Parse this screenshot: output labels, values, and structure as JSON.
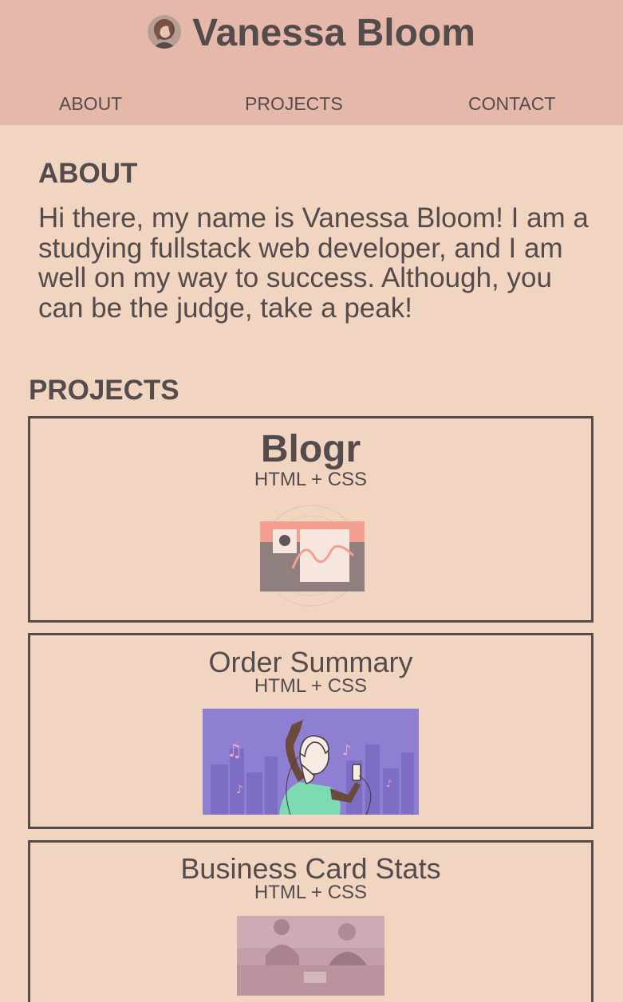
{
  "header": {
    "avatar_icon": "profile-photo",
    "title": "Vanessa Bloom",
    "nav": [
      {
        "label": "ABOUT"
      },
      {
        "label": "PROJECTS"
      },
      {
        "label": "CONTACT"
      }
    ],
    "background_color": "#e6b8a9"
  },
  "about": {
    "heading": "ABOUT",
    "text": "Hi there, my name is Vanessa Bloom! I am a studying fullstack web developer, and I am well on my way to success. Although, you can be the judge, take a peak!"
  },
  "projects": {
    "heading": "PROJECTS",
    "items": [
      {
        "title": "Blogr",
        "tech": "HTML + CSS",
        "image": "blogr-illustration"
      },
      {
        "title": "Order Summary",
        "tech": "HTML + CSS",
        "image": "music-dancer-illustration"
      },
      {
        "title": "Business Card Stats",
        "tech": "HTML + CSS",
        "image": "office-photo"
      }
    ]
  },
  "colors": {
    "page_background": "#f1d5c1",
    "text": "#534b4c",
    "accent_purple": "#8f7fd2"
  }
}
